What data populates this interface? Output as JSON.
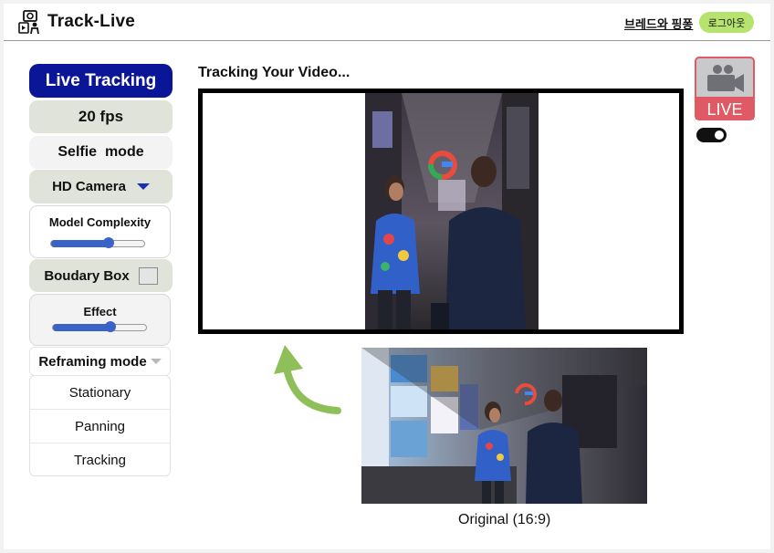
{
  "header": {
    "app_title": "Track-Live",
    "logo_icon": "camera-person-icon",
    "brand_link": "브레드와 핑퐁",
    "logout_label": "로그아웃",
    "logout_color": "#b5e36e"
  },
  "sidebar": {
    "live_tracking": "Live Tracking",
    "fps": "20 fps",
    "selfie": "Selfie  mode",
    "camera": "HD Camera",
    "complexity_title": "Model Complexity",
    "complexity_level": 0.62,
    "boundary": "Boudary Box",
    "effect_title": "Effect",
    "effect_level": 0.62,
    "reframing": "Reframing mode",
    "reframing_options": [
      "Stationary",
      "Panning",
      "Tracking"
    ],
    "accent_color": "#0b1597"
  },
  "main": {
    "tracking_title": "Tracking Your Video...",
    "original_caption": "Original (16:9)",
    "live_label": "LIVE",
    "live_icon": "live-camera-icon",
    "toggle_on": true
  }
}
